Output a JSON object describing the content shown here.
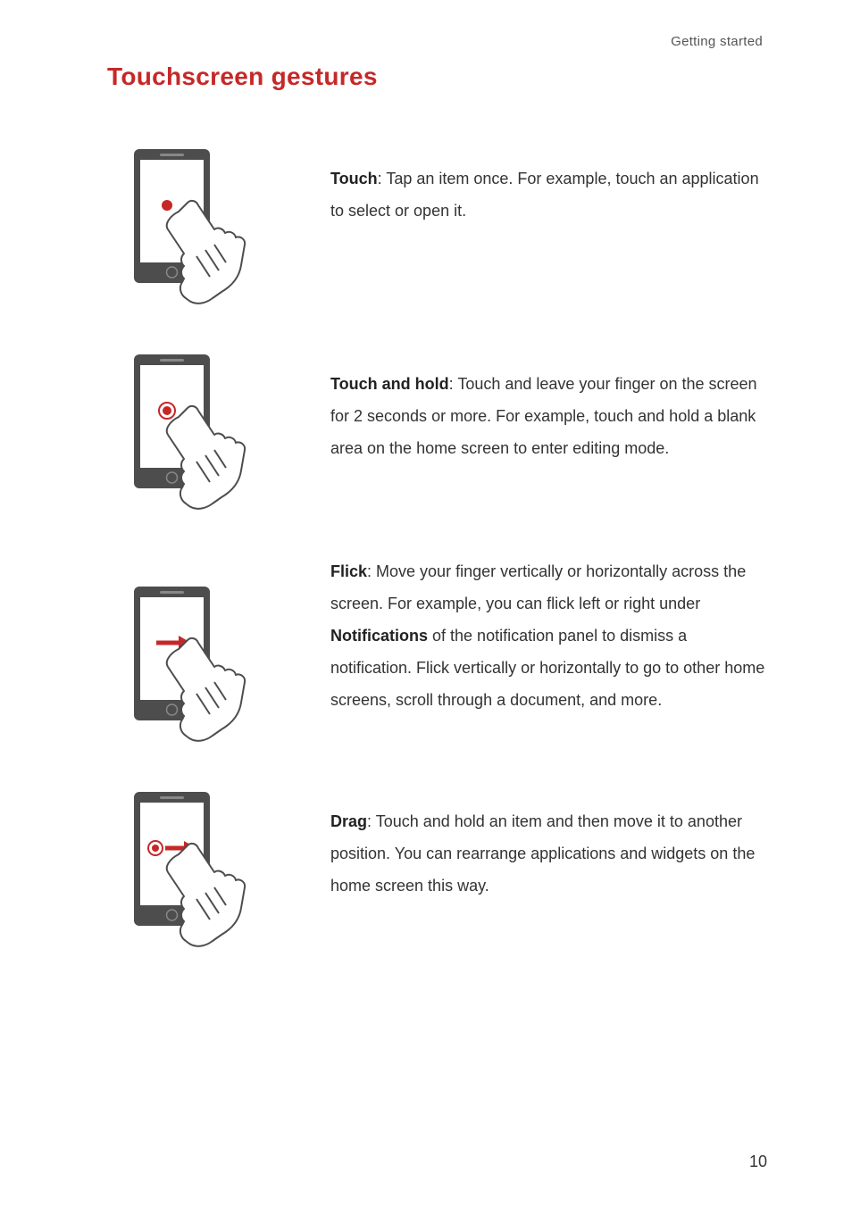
{
  "header": {
    "section": "Getting started"
  },
  "title": "Touchscreen gestures",
  "gestures": [
    {
      "label": "Touch",
      "desc_before": ": Tap an item once. For example, touch an application to select or open it.",
      "bold_mid": "",
      "desc_after": ""
    },
    {
      "label": "Touch and hold",
      "desc_before": ": Touch and leave your finger on the screen for 2 seconds or more. For example, touch and hold a blank area on the home screen to enter editing mode.",
      "bold_mid": "",
      "desc_after": ""
    },
    {
      "label": "Flick",
      "desc_before": ": Move your finger vertically or horizontally across the screen. For example, you can flick left or right under ",
      "bold_mid": "Notifications",
      "desc_after": " of the notification panel to dismiss a notification. Flick vertically or horizontally to go to other home screens, scroll through a document, and more."
    },
    {
      "label": "Drag",
      "desc_before": ": Touch and hold an item and then move it to another position. You can rearrange applications and widgets on the home screen this way.",
      "bold_mid": "",
      "desc_after": ""
    }
  ],
  "page_number": "10"
}
